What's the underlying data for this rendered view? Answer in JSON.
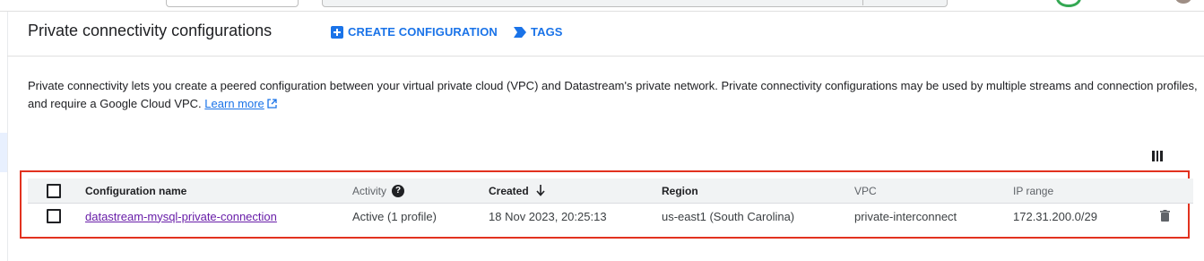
{
  "header": {
    "title": "Private connectivity configurations",
    "create_label": "CREATE CONFIGURATION",
    "tags_label": "TAGS"
  },
  "description": {
    "text": "Private connectivity lets you create a peered configuration between your virtual private cloud (VPC) and Datastream's private network. Private connectivity configurations may be used by multiple streams and connection profiles, and require a Google Cloud VPC. ",
    "learn_more": "Learn more"
  },
  "table": {
    "columns": {
      "name": "Configuration name",
      "activity": "Activity",
      "created": "Created",
      "region": "Region",
      "vpc": "VPC",
      "ip_range": "IP range"
    },
    "rows": [
      {
        "name": "datastream-mysql-private-connection",
        "activity": "Active (1 profile)",
        "created": "18 Nov 2023, 20:25:13",
        "region": "us-east1 (South Carolina)",
        "vpc": "private-interconnect",
        "ip_range": "172.31.200.0/29"
      }
    ]
  },
  "colors": {
    "accent": "#1a73e8",
    "highlight_border": "#e2321f",
    "visited_link": "#681da8"
  },
  "icons": {
    "create": "add-box-icon",
    "tags": "label-icon",
    "external": "open-in-new-icon",
    "columns": "column-display-icon",
    "help": "help-icon",
    "sort": "arrow-downward-icon",
    "delete": "trash-icon"
  }
}
